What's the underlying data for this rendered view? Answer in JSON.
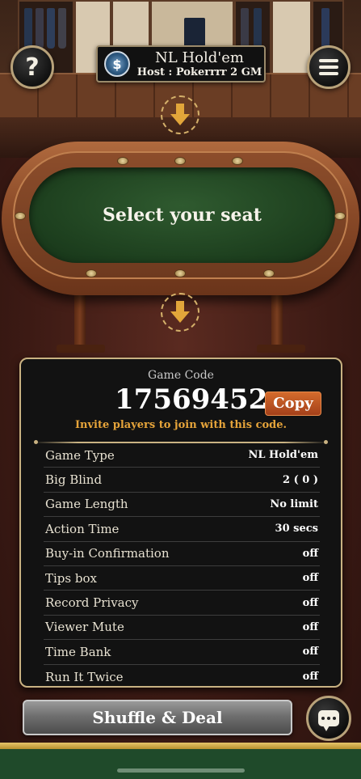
{
  "header": {
    "title": "NL Hold'em",
    "subtitle": "Host : Pokerrrr 2 GM",
    "logo_glyph": "$",
    "help_label": "?",
    "help_icon": "question-mark-icon",
    "menu_icon": "hamburger-menu-icon"
  },
  "table": {
    "prompt": "Select your seat"
  },
  "panel": {
    "game_code_label": "Game Code",
    "game_code": "17569452",
    "copy_label": "Copy",
    "invite_text": "Invite players to join with this code.",
    "settings": [
      {
        "key": "Game Type",
        "value": "NL Hold'em"
      },
      {
        "key": "Big Blind",
        "value": "2 ( 0 )"
      },
      {
        "key": "Game Length",
        "value": "No limit"
      },
      {
        "key": "Action Time",
        "value": "30 secs"
      },
      {
        "key": "Buy-in Confirmation",
        "value": "off"
      },
      {
        "key": "Tips box",
        "value": "off"
      },
      {
        "key": "Record Privacy",
        "value": "off"
      },
      {
        "key": "Viewer Mute",
        "value": "off"
      },
      {
        "key": "Time Bank",
        "value": "off"
      },
      {
        "key": "Run It Twice",
        "value": "off"
      }
    ]
  },
  "footer": {
    "deal_label": "Shuffle & Deal",
    "chat_icon": "chat-bubble-icon"
  },
  "colors": {
    "accent_gold": "#c9b282",
    "copy_orange": "#d46b2c",
    "invite_orange": "#e6a43a",
    "felt_green": "#1d3f1e"
  }
}
